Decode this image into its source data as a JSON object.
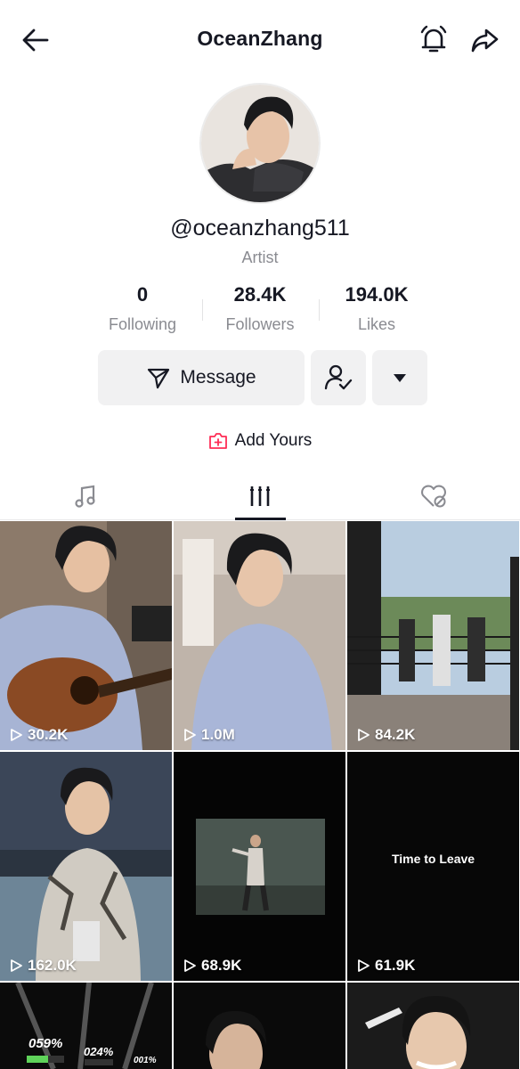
{
  "header": {
    "title": "OceanZhang"
  },
  "profile": {
    "username": "@oceanzhang511",
    "category": "Artist"
  },
  "stats": {
    "following": {
      "value": "0",
      "label": "Following"
    },
    "followers": {
      "value": "28.4K",
      "label": "Followers"
    },
    "likes": {
      "value": "194.0K",
      "label": "Likes"
    }
  },
  "actions": {
    "message_label": "Message",
    "add_yours_label": "Add Yours"
  },
  "videos": [
    {
      "views": "30.2K"
    },
    {
      "views": "1.0M"
    },
    {
      "views": "84.2K"
    },
    {
      "views": "162.0K"
    },
    {
      "views": "68.9K"
    },
    {
      "views": "61.9K",
      "overlay_title": "Time to Leave"
    },
    {
      "overlay_values": [
        "059%",
        "024%",
        "001%"
      ]
    },
    {},
    {}
  ],
  "colors": {
    "accent_red": "#fe2c55",
    "muted_text": "#8a8b91",
    "button_bg": "#f1f1f2"
  }
}
